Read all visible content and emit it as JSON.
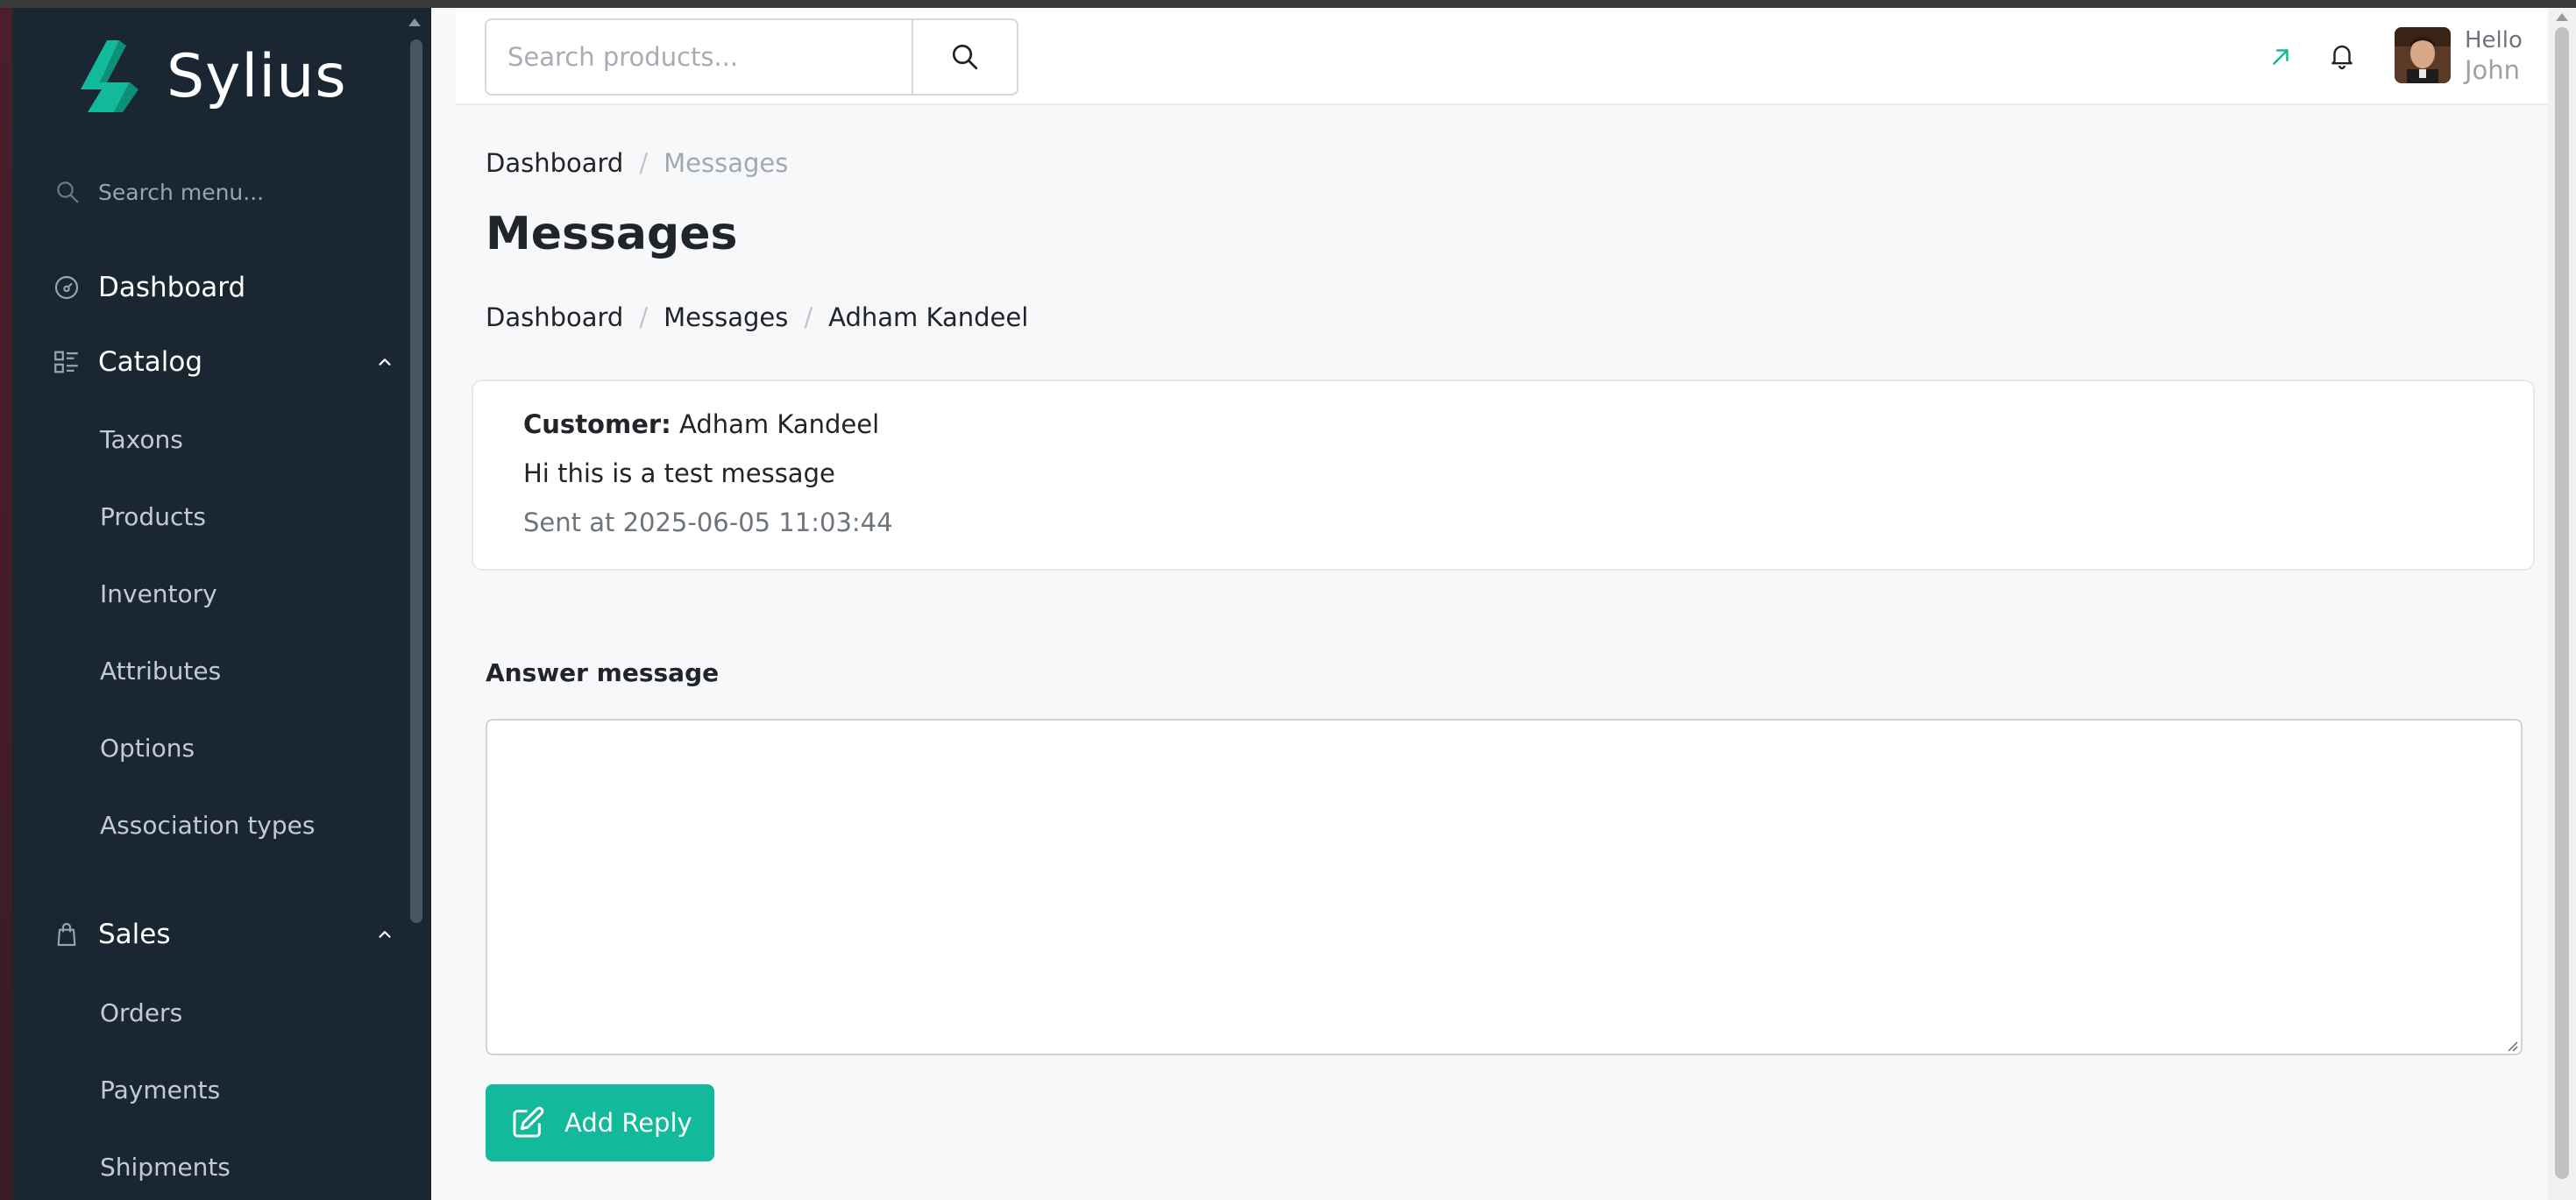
{
  "brand": {
    "name": "Sylius",
    "accent": "#12b99a"
  },
  "sidebar": {
    "search_placeholder": "Search menu...",
    "dashboard": "Dashboard",
    "catalog": {
      "label": "Catalog",
      "items": [
        "Taxons",
        "Products",
        "Inventory",
        "Attributes",
        "Options",
        "Association types"
      ]
    },
    "sales": {
      "label": "Sales",
      "items": [
        "Orders",
        "Payments",
        "Shipments"
      ]
    }
  },
  "header": {
    "search_placeholder": "Search products...",
    "greeting": "Hello",
    "user_name": "John"
  },
  "breadcrumb_top": {
    "first": "Dashboard",
    "current": "Messages",
    "separator": "/"
  },
  "page_title": "Messages",
  "breadcrumb_sub": {
    "first": "Dashboard",
    "second": "Messages",
    "current": "Adham Kandeel",
    "separator": "/"
  },
  "message": {
    "customer_label": "Customer:",
    "customer_name": "Adham Kandeel",
    "body": "Hi this is a test message",
    "sent_at": "Sent at 2025-06-05 11:03:44"
  },
  "form": {
    "label": "Answer message",
    "value": "",
    "submit_label": "Add Reply"
  }
}
